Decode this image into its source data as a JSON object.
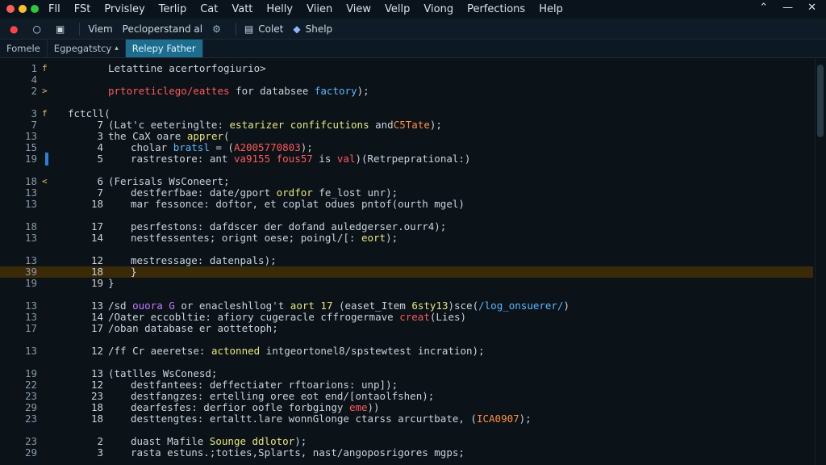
{
  "menubar": {
    "items": [
      "Fll",
      "FSt",
      "Prvisley",
      "Terlip",
      "Cat",
      "Vatt",
      "Helly",
      "Viien",
      "View",
      "Vellp",
      "Viong",
      "Perfections",
      "Help"
    ],
    "controls": [
      "⌃",
      "—",
      "✕"
    ]
  },
  "toolbar": {
    "items": [
      {
        "icon": "●",
        "label": ""
      },
      {
        "icon": "○",
        "label": ""
      },
      {
        "icon": "▣",
        "label": ""
      },
      {
        "icon": "",
        "label": "Viem"
      },
      {
        "icon": "",
        "label": "Pecloperstand al"
      },
      {
        "icon": "⚙",
        "label": ""
      },
      {
        "icon": "▤",
        "label": "Colet"
      },
      {
        "icon": "◆",
        "label": "Shelp"
      }
    ]
  },
  "tabs": [
    {
      "label": "Fomele",
      "active": false
    },
    {
      "label": "Egpegatstcy",
      "active": false
    },
    {
      "label": "Relepy Father",
      "active": true
    }
  ],
  "colors": {
    "accent": "#1d6e8e",
    "highlight": "#3a2a08",
    "keyword": "#e6e87a",
    "error": "#ff5a5a"
  },
  "lines": [
    {
      "n1": "1",
      "mark": "f",
      "n2": "",
      "indent": 0,
      "segs": [
        {
          "t": "Letattine acertorfogiurio>",
          "c": "kw"
        }
      ]
    },
    {
      "n1": "4",
      "mark": "",
      "n2": "",
      "indent": 0,
      "segs": []
    },
    {
      "n1": "2",
      "mark": ">",
      "n2": "",
      "indent": 0,
      "segs": [
        {
          "t": "prtoreticlego/eattes",
          "c": "r"
        },
        {
          "t": " for databsee ",
          "c": "kw"
        },
        {
          "t": "factory",
          "c": "b"
        },
        {
          "t": ");",
          "c": "kw"
        }
      ]
    },
    {
      "n1": "",
      "mark": "",
      "n2": "",
      "indent": 0,
      "segs": []
    },
    {
      "n1": "3",
      "mark": "f",
      "n2": "",
      "indent": -5,
      "segs": [
        {
          "t": "fctcll(",
          "c": "kw"
        }
      ]
    },
    {
      "n1": "7",
      "mark": "",
      "n2": "7",
      "indent": 0,
      "segs": [
        {
          "t": "(Lat'c eeteringlte: ",
          "c": "kw"
        },
        {
          "t": "estarizer confifcutions",
          "c": "g"
        },
        {
          "t": " and",
          "c": "kw"
        },
        {
          "t": "C5Tate",
          "c": "o"
        },
        {
          "t": ");",
          "c": "kw"
        }
      ]
    },
    {
      "n1": "13",
      "mark": "",
      "n2": "3",
      "indent": 0,
      "segs": [
        {
          "t": "the CaX oare ",
          "c": "kw"
        },
        {
          "t": "apprer",
          "c": "g"
        },
        {
          "t": "(",
          "c": "kw"
        }
      ]
    },
    {
      "n1": "15",
      "mark": "",
      "n2": "4",
      "indent": 2,
      "segs": [
        {
          "t": "cholar ",
          "c": "kw"
        },
        {
          "t": "bratsl",
          "c": "b"
        },
        {
          "t": " = (",
          "c": "kw"
        },
        {
          "t": "A2005770803",
          "c": "r"
        },
        {
          "t": ");",
          "c": "kw"
        }
      ]
    },
    {
      "n1": "19",
      "mark": "",
      "n2": "5",
      "indent": 2,
      "segs": [
        {
          "t": "rastrestore: ant ",
          "c": "kw"
        },
        {
          "t": "va9155 fous57",
          "c": "r"
        },
        {
          "t": " is ",
          "c": "kw"
        },
        {
          "t": "val",
          "c": "r"
        },
        {
          "t": ")(Retrpeprational:)",
          "c": "kw"
        }
      ]
    },
    {
      "n1": "",
      "mark": "",
      "n2": "",
      "indent": 0,
      "segs": []
    },
    {
      "n1": "18",
      "mark": "<",
      "n2": "6",
      "indent": 0,
      "segs": [
        {
          "t": "(Ferisals WsConeert;",
          "c": "kw"
        }
      ]
    },
    {
      "n1": "13",
      "mark": "",
      "n2": "7",
      "indent": 2,
      "segs": [
        {
          "t": "destferfbae: date/gport ",
          "c": "kw"
        },
        {
          "t": "ordfor",
          "c": "g"
        },
        {
          "t": " fe_lost unr);",
          "c": "kw"
        }
      ]
    },
    {
      "n1": "13",
      "mark": "",
      "n2": "18",
      "indent": 2,
      "segs": [
        {
          "t": "mar fessonce: doftor, et coplat odues pntof(ourth mgel)",
          "c": "kw"
        }
      ]
    },
    {
      "n1": "",
      "mark": "",
      "n2": "",
      "indent": 0,
      "segs": []
    },
    {
      "n1": "18",
      "mark": "",
      "n2": "17",
      "indent": 2,
      "segs": [
        {
          "t": "pesrfestons: dafdscer der dofand auledgerser.ourr4);",
          "c": "kw"
        }
      ]
    },
    {
      "n1": "13",
      "mark": "",
      "n2": "14",
      "indent": 2,
      "segs": [
        {
          "t": "nestfessentes; orignt oese; poingl/[: ",
          "c": "kw"
        },
        {
          "t": "eort",
          "c": "g"
        },
        {
          "t": ");",
          "c": "kw"
        }
      ]
    },
    {
      "n1": "",
      "mark": "",
      "n2": "",
      "indent": 0,
      "segs": []
    },
    {
      "n1": "13",
      "mark": "",
      "n2": "12",
      "indent": 2,
      "segs": [
        {
          "t": "mestressage: datenpals);",
          "c": "kw"
        }
      ]
    },
    {
      "n1": "39",
      "mark": "",
      "n2": "18",
      "indent": 2,
      "hl": true,
      "segs": [
        {
          "t": "}",
          "c": "kw"
        }
      ]
    },
    {
      "n1": "19",
      "mark": "",
      "n2": "19",
      "indent": 0,
      "segs": [
        {
          "t": "}",
          "c": "kw"
        }
      ]
    },
    {
      "n1": "",
      "mark": "",
      "n2": "",
      "indent": 0,
      "segs": []
    },
    {
      "n1": "13",
      "mark": "",
      "n2": "13",
      "indent": 0,
      "segs": [
        {
          "t": "/sd ",
          "c": "kw"
        },
        {
          "t": "ouora G",
          "c": "p"
        },
        {
          "t": " or enacleshllog't ",
          "c": "kw"
        },
        {
          "t": "aort 17",
          "c": "g"
        },
        {
          "t": " (easet_Item ",
          "c": "kw"
        },
        {
          "t": "6sty13",
          "c": "g"
        },
        {
          "t": ")sce(",
          "c": "kw"
        },
        {
          "t": "/log_onsuerer/",
          "c": "b"
        },
        {
          "t": ")",
          "c": "kw"
        }
      ]
    },
    {
      "n1": "13",
      "mark": "",
      "n2": "14",
      "indent": 0,
      "segs": [
        {
          "t": "/Oater eccobltie: afiory cugeracle cffrogermave ",
          "c": "kw"
        },
        {
          "t": "creat",
          "c": "r"
        },
        {
          "t": "(Lies)",
          "c": "kw"
        }
      ]
    },
    {
      "n1": "17",
      "mark": "",
      "n2": "17",
      "indent": 0,
      "segs": [
        {
          "t": "/oban database er aottetoph;",
          "c": "kw"
        }
      ]
    },
    {
      "n1": "",
      "mark": "",
      "n2": "",
      "indent": 0,
      "segs": []
    },
    {
      "n1": "13",
      "mark": "",
      "n2": "12",
      "indent": 0,
      "segs": [
        {
          "t": "/ff Cr aeeretse: ",
          "c": "kw"
        },
        {
          "t": "actonned",
          "c": "g"
        },
        {
          "t": " intgeortonel8/spstewtest incration);",
          "c": "kw"
        }
      ]
    },
    {
      "n1": "",
      "mark": "",
      "n2": "",
      "indent": 0,
      "segs": []
    },
    {
      "n1": "19",
      "mark": "",
      "n2": "13",
      "indent": 0,
      "segs": [
        {
          "t": "(tatlles WsConesd;",
          "c": "kw"
        }
      ]
    },
    {
      "n1": "22",
      "mark": "",
      "n2": "12",
      "indent": 2,
      "segs": [
        {
          "t": "destfantees: deffectiater rftoarions: unp]);",
          "c": "kw"
        }
      ]
    },
    {
      "n1": "23",
      "mark": "",
      "n2": "23",
      "indent": 2,
      "segs": [
        {
          "t": "destfangzes: ertelling oree eot end/[ontaolfshen);",
          "c": "kw"
        }
      ]
    },
    {
      "n1": "29",
      "mark": "",
      "n2": "18",
      "indent": 2,
      "segs": [
        {
          "t": "dearfesfes: derfior oofle forbgingy ",
          "c": "kw"
        },
        {
          "t": "eme",
          "c": "r"
        },
        {
          "t": "))",
          "c": "kw"
        }
      ]
    },
    {
      "n1": "23",
      "mark": "",
      "n2": "18",
      "indent": 2,
      "segs": [
        {
          "t": "desttengtes: ertaltt.lare wonnGlonge ctarss arcurtbate, (",
          "c": "kw"
        },
        {
          "t": "ICA0907",
          "c": "o"
        },
        {
          "t": ");",
          "c": "kw"
        }
      ]
    },
    {
      "n1": "",
      "mark": "",
      "n2": "",
      "indent": 0,
      "segs": []
    },
    {
      "n1": "23",
      "mark": "",
      "n2": "2",
      "indent": 2,
      "segs": [
        {
          "t": "duast Mafile ",
          "c": "kw"
        },
        {
          "t": "Sounge ddlotor",
          "c": "g"
        },
        {
          "t": ");",
          "c": "kw"
        }
      ]
    },
    {
      "n1": "29",
      "mark": "",
      "n2": "3",
      "indent": 2,
      "segs": [
        {
          "t": "rasta estuns.;toties,Splarts, nast/angoposrigores mgps;",
          "c": "kw"
        }
      ]
    },
    {
      "n1": "",
      "mark": "",
      "n2": "",
      "indent": 0,
      "segs": []
    }
  ]
}
